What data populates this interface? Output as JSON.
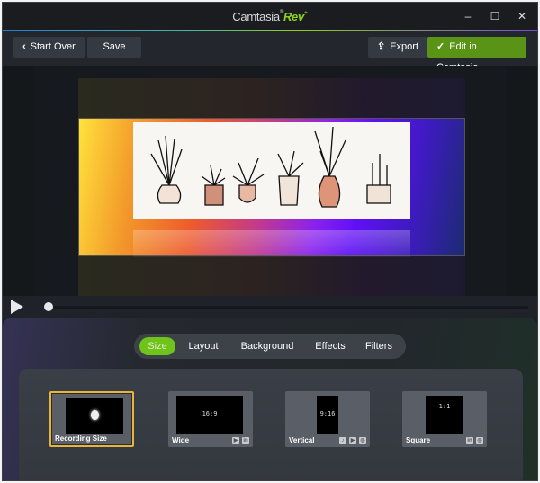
{
  "window": {
    "title_prefix": "Camtasia",
    "title_reg": "®",
    "title_brand": "Rev",
    "title_star": "+",
    "controls": {
      "minimize": "–",
      "maximize": "☐",
      "close": "✕"
    }
  },
  "toolbar": {
    "start_over_label": "Start Over",
    "start_over_icon": "‹",
    "save_label": "Save",
    "export_label": "Export",
    "export_icon": "⇪",
    "edit_label": "Edit in Camtasia",
    "edit_icon": "✓"
  },
  "colors": {
    "accent_green": "#5a9416",
    "active_tab": "#6fc41a",
    "selected_border": "#e8b43a"
  },
  "timeline": {
    "progress": 0
  },
  "tabs": [
    {
      "label": "Size",
      "active": true
    },
    {
      "label": "Layout",
      "active": false
    },
    {
      "label": "Background",
      "active": false
    },
    {
      "label": "Effects",
      "active": false
    },
    {
      "label": "Filters",
      "active": false
    }
  ],
  "sizes": [
    {
      "label": "Recording Size",
      "ratio": "",
      "selected": true,
      "icons": []
    },
    {
      "label": "Wide",
      "ratio": "16:9",
      "selected": false,
      "icons": [
        "youtube-icon",
        "linkedin-icon"
      ]
    },
    {
      "label": "Vertical",
      "ratio": "9:16",
      "selected": false,
      "icons": [
        "tiktok-icon",
        "youtube-icon",
        "instagram-icon"
      ]
    },
    {
      "label": "Square",
      "ratio": "1:1",
      "selected": false,
      "icons": [
        "linkedin-icon",
        "instagram-icon"
      ]
    }
  ],
  "icon_glyphs": {
    "youtube": "▶",
    "linkedin": "in",
    "tiktok": "♪",
    "instagram": "◎"
  }
}
